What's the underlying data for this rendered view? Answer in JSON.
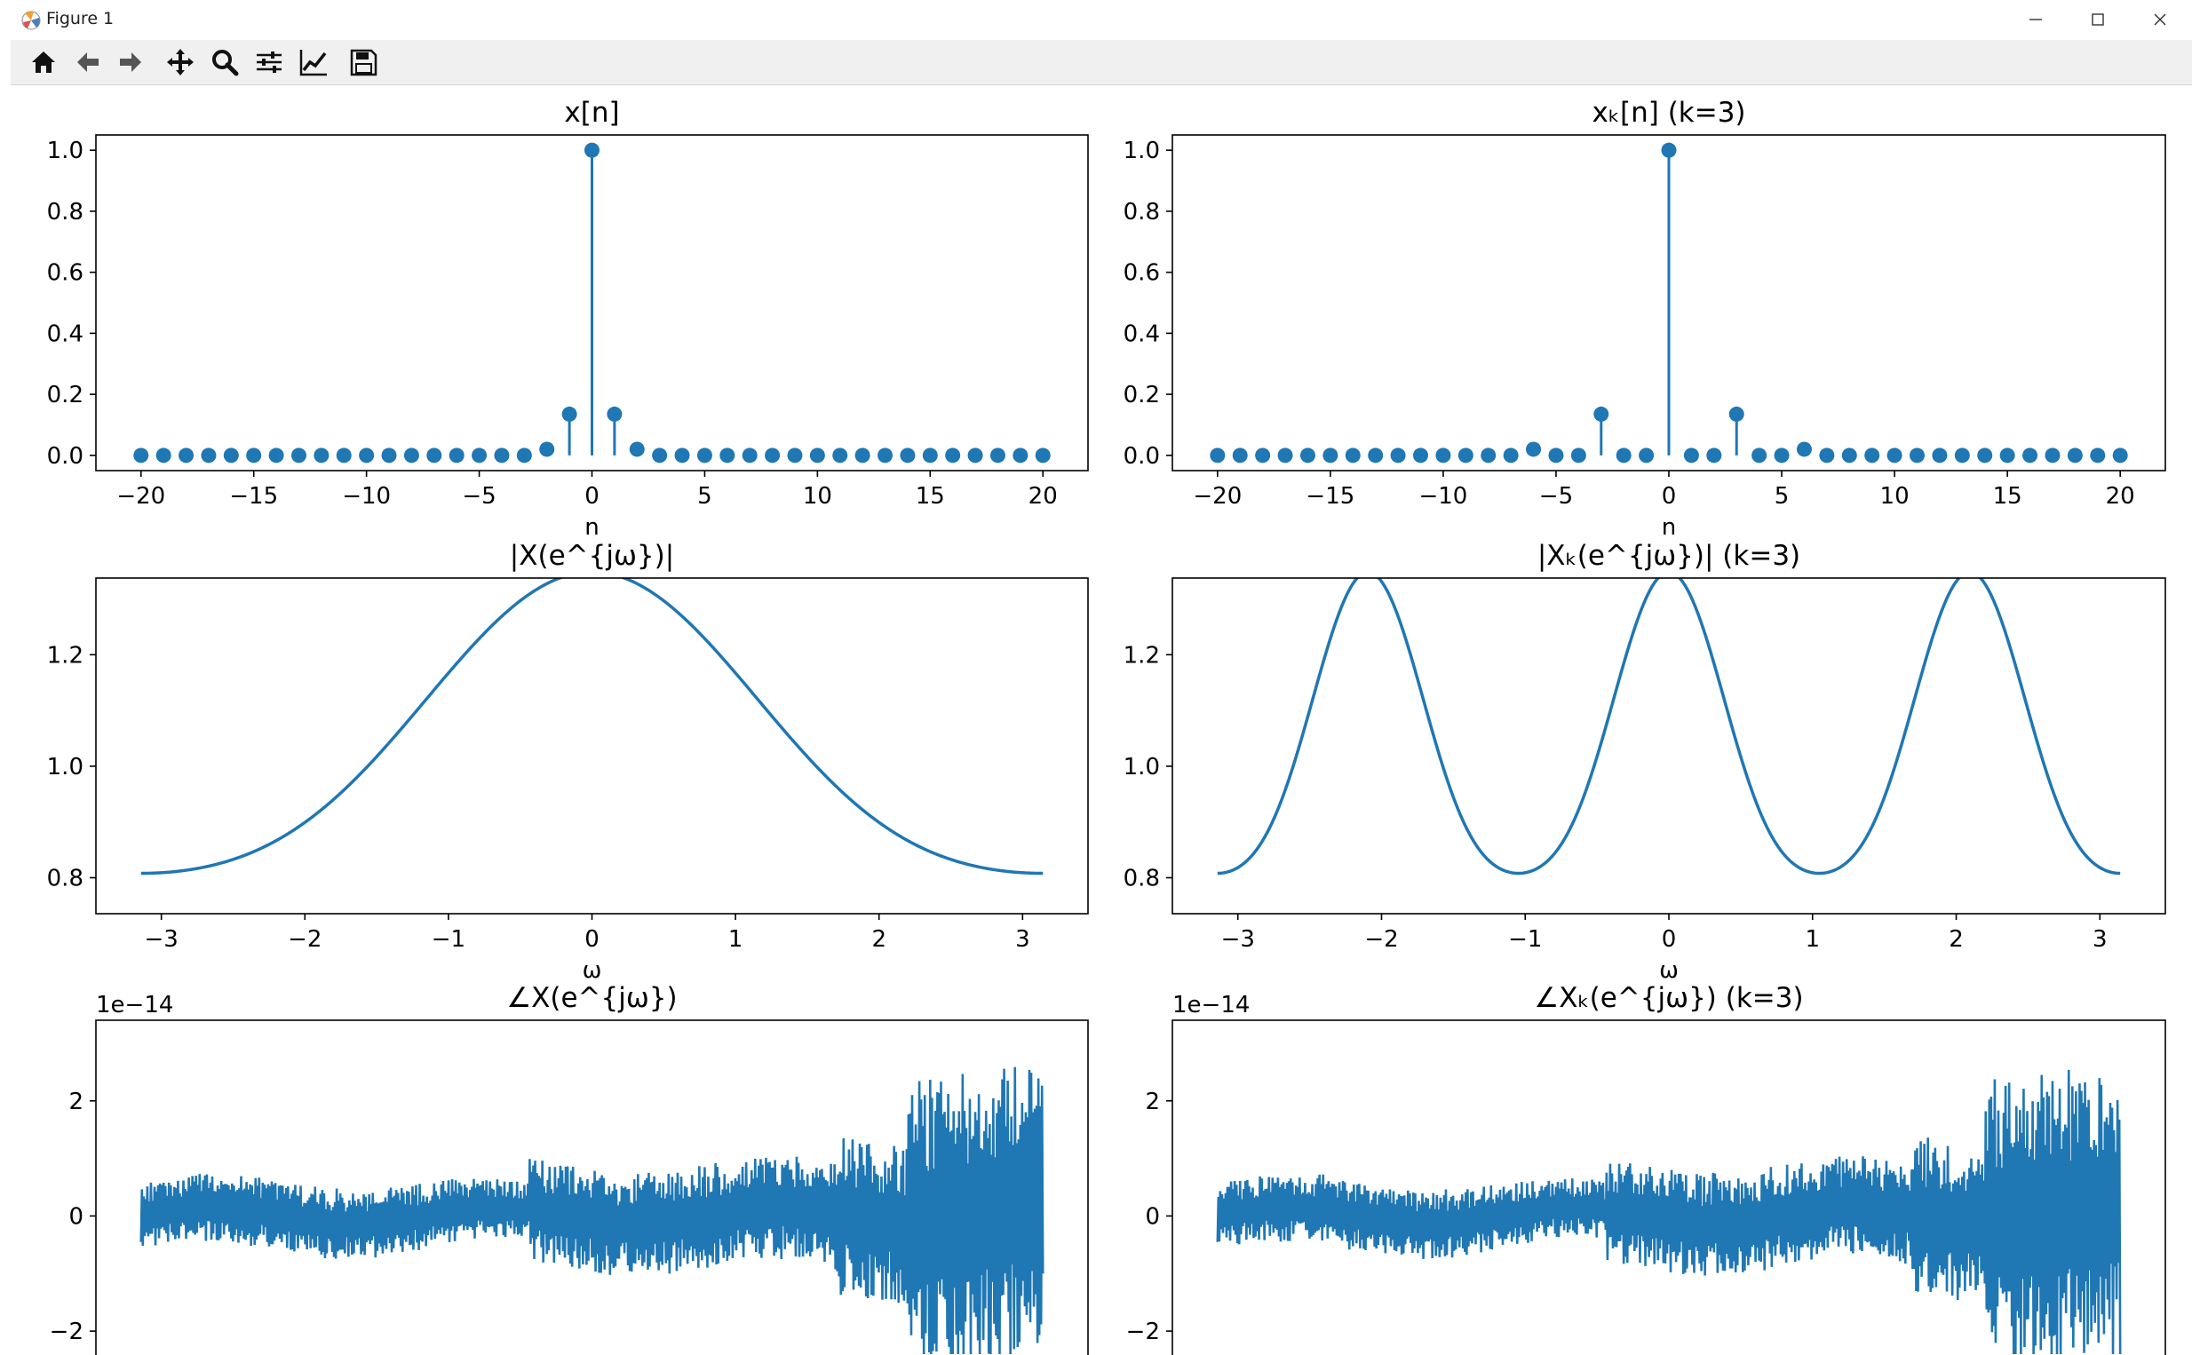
{
  "window": {
    "title": "Figure 1",
    "controls": [
      "minimize",
      "maximize",
      "close"
    ]
  },
  "toolbar": {
    "tools": [
      {
        "name": "home-icon",
        "tooltip": "Reset original view"
      },
      {
        "name": "back-arrow-icon",
        "tooltip": "Back to previous view"
      },
      {
        "name": "forward-arrow-icon",
        "tooltip": "Forward to next view"
      },
      {
        "name": "pan-icon",
        "tooltip": "Pan"
      },
      {
        "name": "zoom-icon",
        "tooltip": "Zoom to rectangle"
      },
      {
        "name": "subplots-icon",
        "tooltip": "Configure subplots"
      },
      {
        "name": "axes-edit-icon",
        "tooltip": "Edit axis"
      },
      {
        "name": "save-icon",
        "tooltip": "Save the figure"
      }
    ]
  },
  "colors": {
    "series": "#1f77b4",
    "axes": "#000000",
    "toolbar_bg": "#f0f0f0"
  },
  "chart_data": [
    {
      "id": "x-n",
      "type": "stem",
      "title": "x[n]",
      "xlabel": "n",
      "x": [
        -20,
        -19,
        -18,
        -17,
        -16,
        -15,
        -14,
        -13,
        -12,
        -11,
        -10,
        -9,
        -8,
        -7,
        -6,
        -5,
        -4,
        -3,
        -2,
        -1,
        0,
        1,
        2,
        3,
        4,
        5,
        6,
        7,
        8,
        9,
        10,
        11,
        12,
        13,
        14,
        15,
        16,
        17,
        18,
        19,
        20
      ],
      "y": [
        0,
        0,
        0,
        0,
        0,
        0,
        0,
        0,
        0,
        0,
        0,
        0,
        0,
        0,
        0,
        0,
        0,
        0,
        0.02,
        0.135,
        1.0,
        0.135,
        0.02,
        0,
        0,
        0,
        0,
        0,
        0,
        0,
        0,
        0,
        0,
        0,
        0,
        0,
        0,
        0,
        0,
        0,
        0
      ],
      "xlim": [
        -22,
        22
      ],
      "ylim": [
        -0.05,
        1.05
      ],
      "xticks": [
        -20,
        -15,
        -10,
        -5,
        0,
        5,
        10,
        15,
        20
      ],
      "xtick_labels": [
        "−20",
        "−15",
        "−10",
        "−5",
        "0",
        "5",
        "10",
        "15",
        "20"
      ],
      "yticks": [
        0.0,
        0.2,
        0.4,
        0.6,
        0.8,
        1.0
      ],
      "ytick_labels": [
        "0.0",
        "0.2",
        "0.4",
        "0.6",
        "0.8",
        "1.0"
      ]
    },
    {
      "id": "xk-n",
      "type": "stem",
      "title": "xₖ[n] (k=3)",
      "xlabel": "n",
      "x": [
        -20,
        -19,
        -18,
        -17,
        -16,
        -15,
        -14,
        -13,
        -12,
        -11,
        -10,
        -9,
        -8,
        -7,
        -6,
        -5,
        -4,
        -3,
        -2,
        -1,
        0,
        1,
        2,
        3,
        4,
        5,
        6,
        7,
        8,
        9,
        10,
        11,
        12,
        13,
        14,
        15,
        16,
        17,
        18,
        19,
        20
      ],
      "y": [
        0,
        0,
        0,
        0,
        0,
        0,
        0,
        0,
        0,
        0,
        0,
        0,
        0,
        0,
        0.02,
        0,
        0,
        0.135,
        0,
        0,
        1.0,
        0,
        0,
        0.135,
        0,
        0,
        0.02,
        0,
        0,
        0,
        0,
        0,
        0,
        0,
        0,
        0,
        0,
        0,
        0,
        0,
        0
      ],
      "xlim": [
        -22,
        22
      ],
      "ylim": [
        -0.05,
        1.05
      ],
      "xticks": [
        -20,
        -15,
        -10,
        -5,
        0,
        5,
        10,
        15,
        20
      ],
      "xtick_labels": [
        "−20",
        "−15",
        "−10",
        "−5",
        "0",
        "5",
        "10",
        "15",
        "20"
      ],
      "yticks": [
        0.0,
        0.2,
        0.4,
        0.6,
        0.8,
        1.0
      ],
      "ytick_labels": [
        "0.0",
        "0.2",
        "0.4",
        "0.6",
        "0.8",
        "1.0"
      ]
    },
    {
      "id": "mag-X",
      "type": "line",
      "title": "|X(e^{jω})|",
      "xlabel": "ω",
      "function": "1.0379 + 0.2702*cos(w) + 0.0402*cos(2*w)",
      "k": 1,
      "xrange": [
        -3.14159,
        3.14159
      ],
      "xlim": [
        -3.4558,
        3.4558
      ],
      "ylim": [
        0.7355,
        1.3375
      ],
      "xticks": [
        -3,
        -2,
        -1,
        0,
        1,
        2,
        3
      ],
      "xtick_labels": [
        "−3",
        "−2",
        "−1",
        "0",
        "1",
        "2",
        "3"
      ],
      "yticks": [
        0.8,
        1.0,
        1.2
      ],
      "ytick_labels": [
        "0.8",
        "1.0",
        "1.2"
      ]
    },
    {
      "id": "mag-Xk",
      "type": "line",
      "title": "|Xₖ(e^{jω})| (k=3)",
      "xlabel": "ω",
      "function": "1.0379 + 0.2702*cos(3*w) + 0.0402*cos(6*w)",
      "k": 3,
      "xrange": [
        -3.14159,
        3.14159
      ],
      "xlim": [
        -3.4558,
        3.4558
      ],
      "ylim": [
        0.7355,
        1.3375
      ],
      "xticks": [
        -3,
        -2,
        -1,
        0,
        1,
        2,
        3
      ],
      "xtick_labels": [
        "−3",
        "−2",
        "−1",
        "0",
        "1",
        "2",
        "3"
      ],
      "yticks": [
        0.8,
        1.0,
        1.2
      ],
      "ytick_labels": [
        "0.8",
        "1.0",
        "1.2"
      ]
    },
    {
      "id": "phase-X",
      "type": "line",
      "title": "∠X(e^{jω})",
      "offset_text": "1e−14",
      "description": "numerical round-off noise around zero, amplitude grows toward ω = π",
      "xrange": [
        -3.14159,
        3.14159
      ],
      "value_range": [
        -2.4,
        3.2
      ],
      "xlim": [
        -3.4558,
        3.4558
      ],
      "ylim": [
        -2.6,
        3.4
      ],
      "yticks": [
        -2,
        0,
        2
      ],
      "ytick_labels": [
        "−2",
        "0",
        "2"
      ]
    },
    {
      "id": "phase-Xk",
      "type": "line",
      "title": "∠Xₖ(e^{jω}) (k=3)",
      "offset_text": "1e−14",
      "description": "numerical round-off noise around zero, amplitude grows toward ω = π",
      "xrange": [
        -3.14159,
        3.14159
      ],
      "value_range": [
        -2.4,
        3.2
      ],
      "xlim": [
        -3.4558,
        3.4558
      ],
      "ylim": [
        -2.6,
        3.4
      ],
      "yticks": [
        -2,
        0,
        2
      ],
      "ytick_labels": [
        "−2",
        "0",
        "2"
      ]
    }
  ]
}
